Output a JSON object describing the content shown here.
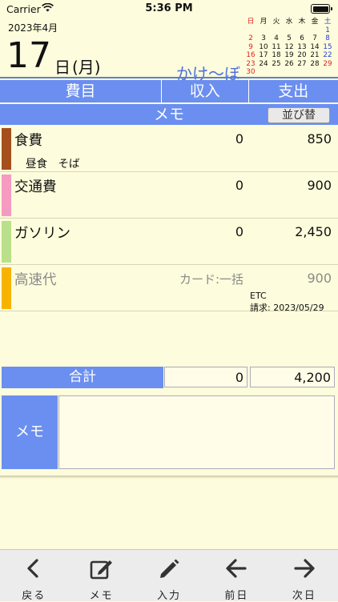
{
  "status_bar": {
    "carrier": "Carrier",
    "time": "5:36 PM"
  },
  "header": {
    "year_month": "2023年4月",
    "day": "17",
    "day_unit": "日",
    "weekday": "(月)",
    "app_name": "かけ〜ぼ"
  },
  "mini_calendar": {
    "weekdays": [
      "日",
      "月",
      "火",
      "水",
      "木",
      "金",
      "土"
    ],
    "weeks": [
      [
        "",
        "",
        "",
        "",
        "",
        "",
        "1"
      ],
      [
        "2",
        "3",
        "4",
        "5",
        "6",
        "7",
        "8"
      ],
      [
        "9",
        "10",
        "11",
        "12",
        "13",
        "14",
        "15"
      ],
      [
        "16",
        "17",
        "18",
        "19",
        "20",
        "21",
        "22"
      ],
      [
        "23",
        "24",
        "25",
        "26",
        "27",
        "28",
        "29"
      ],
      [
        "30",
        "",
        "",
        "",
        "",
        "",
        ""
      ]
    ]
  },
  "table_header": {
    "category": "費目",
    "income": "収入",
    "expense": "支出",
    "memo": "メモ",
    "sort_button": "並び替"
  },
  "entries": [
    {
      "category": "食費",
      "income": "0",
      "expense": "850",
      "memo": "昼食　そば",
      "color": "#a44f1c",
      "dim": false
    },
    {
      "category": "交通費",
      "income": "0",
      "expense": "900",
      "memo": "",
      "color": "#f59ac2",
      "dim": false
    },
    {
      "category": "ガソリン",
      "income": "0",
      "expense": "2,450",
      "memo": "",
      "color": "#b9e08a",
      "dim": false
    },
    {
      "category": "高速代",
      "income": "カード:一括",
      "expense": "900",
      "memo": "",
      "color": "#f8b300",
      "dim": true,
      "sub1": "ETC",
      "sub2": "請求: 2023/05/29"
    }
  ],
  "totals": {
    "label": "合計",
    "income": "0",
    "expense": "4,200"
  },
  "memo_box": {
    "label": "メモ",
    "text": ""
  },
  "toolbar": [
    {
      "label": "戻る",
      "icon": "chevron-left-icon"
    },
    {
      "label": "メモ",
      "icon": "edit-note-icon"
    },
    {
      "label": "入力",
      "icon": "pencil-icon"
    },
    {
      "label": "前日",
      "icon": "arrow-left-icon"
    },
    {
      "label": "次日",
      "icon": "arrow-right-icon"
    }
  ],
  "colors": {
    "accent": "#6b8ff0",
    "background": "#fdfcdc",
    "app_name": "#4b6fd6"
  }
}
